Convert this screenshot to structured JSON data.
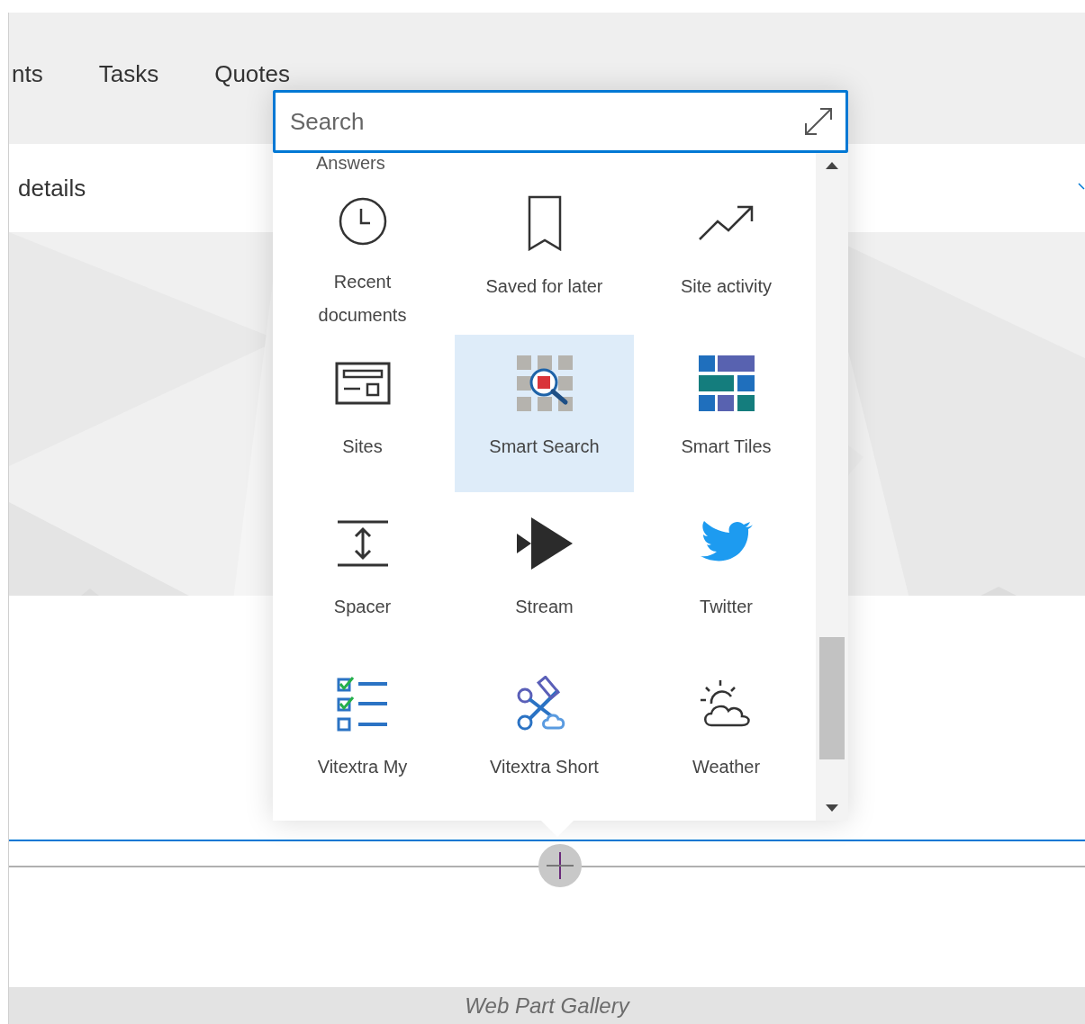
{
  "nav": {
    "tabs": [
      {
        "label": "nts",
        "selected": false
      },
      {
        "label": "Tasks",
        "selected": false
      },
      {
        "label": "Quotes",
        "selected": false
      }
    ]
  },
  "header": {
    "title": "details"
  },
  "gallery": {
    "search": {
      "placeholder": "Search"
    },
    "section_label": "Answers",
    "items": [
      {
        "label": "Recent documents",
        "selected": false
      },
      {
        "label": "Saved for later",
        "selected": false
      },
      {
        "label": "Site activity",
        "selected": false
      },
      {
        "label": "Sites",
        "selected": false
      },
      {
        "label": "Smart Search",
        "selected": true
      },
      {
        "label": "Smart Tiles",
        "selected": false
      },
      {
        "label": "Spacer",
        "selected": false
      },
      {
        "label": "Stream",
        "selected": false
      },
      {
        "label": "Twitter",
        "selected": false
      },
      {
        "label": "Vitextra My",
        "selected": false
      },
      {
        "label": "Vitextra Short",
        "selected": false
      },
      {
        "label": "Weather",
        "selected": false
      }
    ]
  },
  "caption": "Web Part Gallery"
}
